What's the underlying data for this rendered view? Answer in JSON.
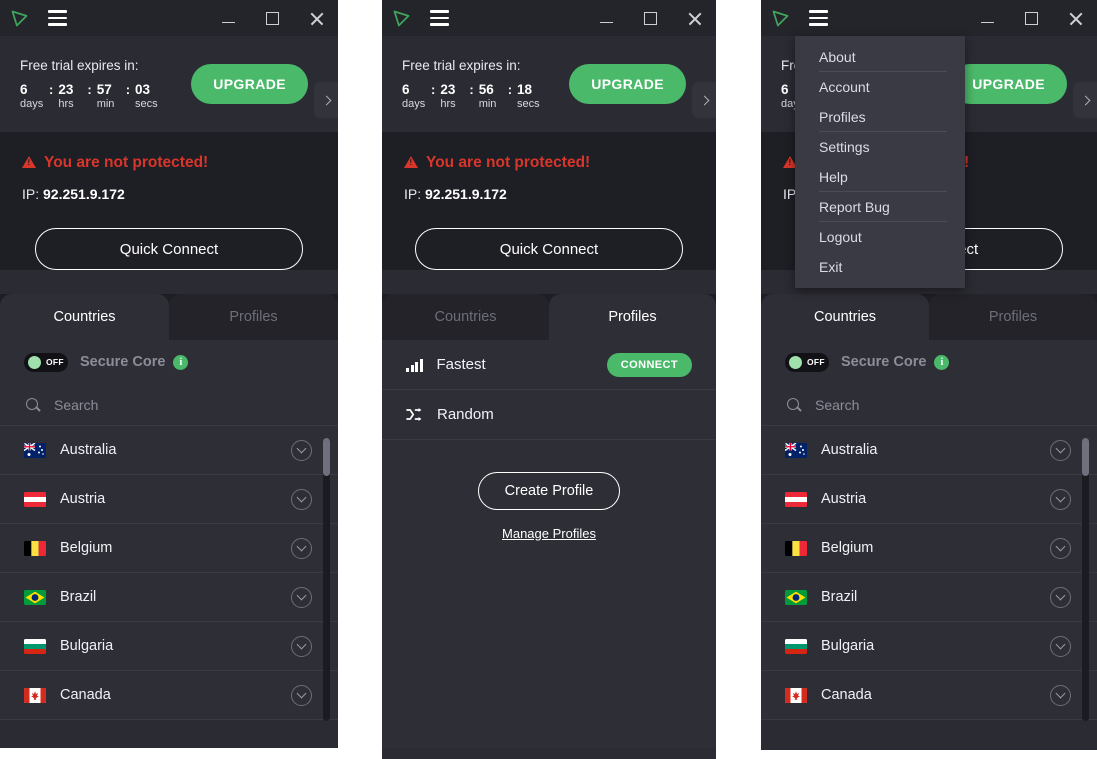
{
  "app": {
    "logo_icon": "protonvpn-logo-icon",
    "menu_icon": "hamburger-menu-icon",
    "minimize_icon": "minimize-icon",
    "maximize_icon": "maximize-icon",
    "close_icon": "close-icon",
    "accent_green": "#4bb96a",
    "danger_red": "#d9362b",
    "bg_dark": "#1e1e25",
    "bg_panel": "#2e2e36",
    "titlebar_bg": "#24242b"
  },
  "trial": {
    "title": "Free trial expires in:",
    "upgrade_label": "UPGRADE",
    "next_icon": "chevron-right-icon",
    "sep": ":",
    "units": [
      "days",
      "hrs",
      "min",
      "secs"
    ],
    "window1_values": [
      "6",
      "23",
      "57",
      "03"
    ],
    "window2_values": [
      "6",
      "23",
      "56",
      "18"
    ]
  },
  "status": {
    "warning_icon": "warning-triangle-icon",
    "warning_text": "You are not protected!",
    "ip_label": "IP:",
    "ip_value": "92.251.9.172",
    "quick_connect_label": "Quick Connect"
  },
  "tabs": {
    "countries": "Countries",
    "profiles": "Profiles"
  },
  "secure_core": {
    "toggle_state": "OFF",
    "label": "Secure Core",
    "info_icon": "info-icon",
    "info_glyph": "i"
  },
  "search": {
    "icon": "search-icon",
    "placeholder": "Search",
    "value": ""
  },
  "countries": [
    {
      "name": "Australia",
      "flag": "au",
      "expand_icon": "chevron-down-icon"
    },
    {
      "name": "Austria",
      "flag": "at",
      "expand_icon": "chevron-down-icon"
    },
    {
      "name": "Belgium",
      "flag": "be",
      "expand_icon": "chevron-down-icon"
    },
    {
      "name": "Brazil",
      "flag": "br",
      "expand_icon": "chevron-down-icon"
    },
    {
      "name": "Bulgaria",
      "flag": "bg",
      "expand_icon": "chevron-down-icon"
    },
    {
      "name": "Canada",
      "flag": "ca",
      "expand_icon": "chevron-down-icon"
    }
  ],
  "profiles": {
    "rows": [
      {
        "name": "Fastest",
        "icon": "signal-bars-icon",
        "action": "CONNECT"
      },
      {
        "name": "Random",
        "icon": "shuffle-icon",
        "action": ""
      }
    ],
    "create_label": "Create Profile",
    "manage_label": "Manage Profiles"
  },
  "menu": {
    "items": [
      {
        "label": "About",
        "separator": true
      },
      {
        "label": "Account",
        "separator": false
      },
      {
        "label": "Profiles",
        "separator": true
      },
      {
        "label": "Settings",
        "separator": false
      },
      {
        "label": "Help",
        "separator": true
      },
      {
        "label": "Report Bug",
        "separator": true
      },
      {
        "label": "Logout",
        "separator": false
      },
      {
        "label": "Exit",
        "separator": false
      }
    ]
  }
}
